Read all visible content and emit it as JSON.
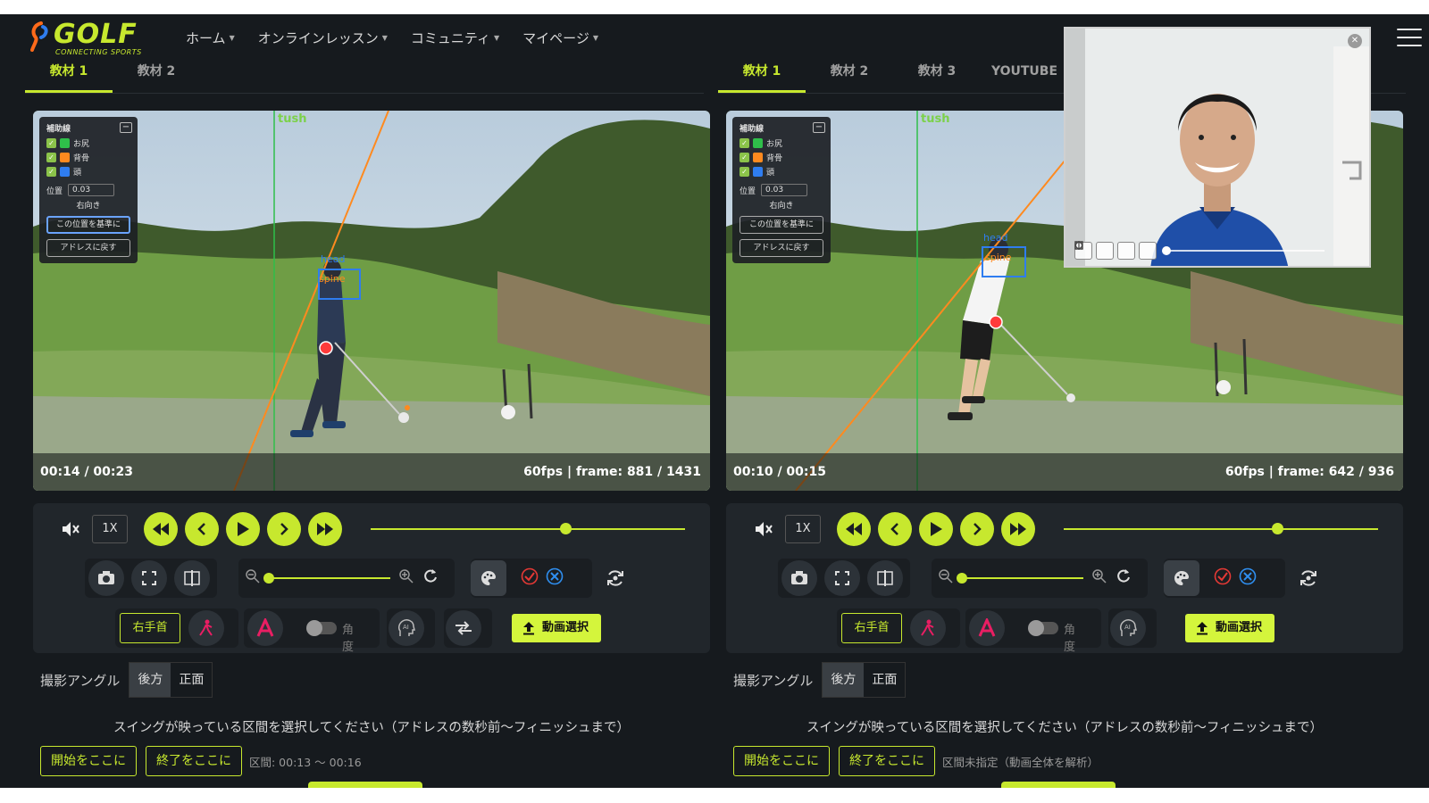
{
  "brand": {
    "logo_text": "GOLF",
    "logo_sub": "CONNECTING SPORTS"
  },
  "nav": {
    "items": [
      {
        "label": "ホーム"
      },
      {
        "label": "オンラインレッスン"
      },
      {
        "label": "コミュニティ"
      },
      {
        "label": "マイページ"
      }
    ]
  },
  "left": {
    "tabs": [
      {
        "label": "教材 1",
        "active": true
      },
      {
        "label": "教材 2",
        "active": false
      }
    ],
    "video": {
      "time": "00:14 / 00:23",
      "fps_frame": "60fps | frame: 881 / 1431",
      "overlay_label": "tush"
    },
    "range": {
      "start_button": "開始をここに",
      "end_button": "終了をここに",
      "text": "区間: 00:13 〜 00:16"
    },
    "seek_progress": 0.62,
    "zoom_level": 0.0
  },
  "right": {
    "tabs": [
      {
        "label": "教材 1",
        "active": true
      },
      {
        "label": "教材 2",
        "active": false
      },
      {
        "label": "教材 3",
        "active": false
      },
      {
        "label": "YOUTUBE",
        "active": false
      }
    ],
    "video": {
      "time": "00:10 / 00:15",
      "fps_frame": "60fps | frame: 642 / 936",
      "overlay_label": "tush"
    },
    "range": {
      "start_button": "開始をここに",
      "end_button": "終了をここに",
      "text": "区間未指定（動画全体を解析）"
    },
    "seek_progress": 0.68,
    "zoom_level": 0.0
  },
  "aux_panel": {
    "title": "補助線",
    "lines": [
      {
        "label": "お尻",
        "color": "#2fbf4a",
        "checked": true
      },
      {
        "label": "背骨",
        "color": "#ff8a1f",
        "checked": true
      },
      {
        "label": "頭",
        "color": "#2f7df0",
        "checked": true
      }
    ],
    "position_label": "位置",
    "position_value": "0.03",
    "direction": "右向き",
    "set_button": "この位置を基準に",
    "reset_button": "アドレスに戻す"
  },
  "controls": {
    "speed": "1X",
    "wrist_button": "右手首",
    "angle_label": "角度",
    "angle_toggle_on": false,
    "upload_button": "動画選択"
  },
  "angle": {
    "label": "撮影アングル",
    "options": [
      "後方",
      "正面"
    ],
    "selected": "後方"
  },
  "instruction": "スイングが映っている区間を選択してください（アドレスの数秒前〜フィニッシュまで）",
  "colors": {
    "accent": "#c7e82e",
    "background": "#161a1e",
    "panel": "#21262b",
    "check_red": "#e53935",
    "check_blue": "#2f8ff0",
    "wrist_pink": "#e91e63"
  },
  "icons": [
    "mute-icon",
    "rewind-icon",
    "prev-frame-icon",
    "play-icon",
    "next-frame-icon",
    "fast-forward-icon",
    "camera-icon",
    "fullscreen-icon",
    "split-icon",
    "zoom-out-icon",
    "zoom-in-icon",
    "reset-icon",
    "palette-icon",
    "check-circle-icon",
    "close-circle-icon",
    "sync-icon",
    "golfer-icon",
    "a-logo-icon",
    "ai-head-icon",
    "swap-icon",
    "upload-icon",
    "menu-icon",
    "close-icon"
  ]
}
